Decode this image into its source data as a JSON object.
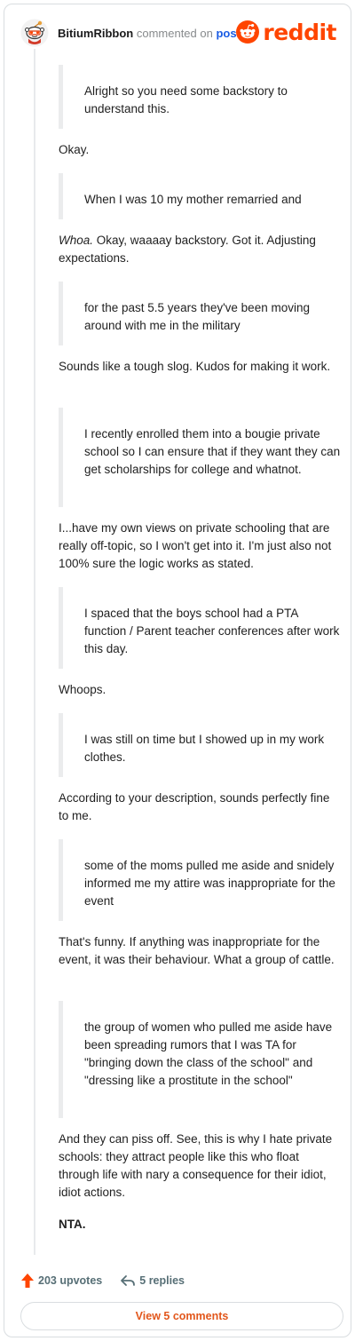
{
  "header": {
    "username": "BitiumRibbon",
    "action_text": "commented on",
    "post_link": "post",
    "brand": "reddit"
  },
  "comment": {
    "quotes": [
      "Alright so you need some backstory to understand this.",
      "When I was 10 my mother remarried and",
      "for the past 5.5 years they've been moving around with me in the military",
      "I recently enrolled them into a bougie private school so I can ensure that if they want they can get scholarships for college and whatnot.",
      "I spaced that the boys school had a PTA function / Parent teacher conferences after work this day.",
      "I was still on time but I showed up in my work clothes.",
      "some of the moms pulled me aside and snidely informed me my attire was inappropriate for the event",
      "the group of women who pulled me aside have been spreading rumors that I was TA for \"bringing down the class of the school\" and \"dressing like a prostitute in the school\""
    ],
    "replies": [
      "Okay.",
      "Okay, waaaay backstory. Got it. Adjusting expectations.",
      "Sounds like a tough slog. Kudos for making it work.",
      "I...have my own views on private schooling that are really off-topic, so I won't get into it. I'm just also not 100% sure the logic works as stated.",
      "Whoops.",
      "According to your description, sounds perfectly fine to me.",
      "That's funny. If anything was inappropriate for the event, it was their behaviour. What a group of cattle.",
      "And they can piss off. See, this is why I hate private schools: they attract people like this who float through life with nary a consequence for their idiot, idiot actions.",
      "NTA."
    ],
    "reply_2_emphasis": "Whoa."
  },
  "footer": {
    "upvotes": "203 upvotes",
    "replies": "5 replies",
    "view_comments": "View 5 comments"
  },
  "colors": {
    "brand": "#ff4500",
    "link": "#1a5ce4",
    "muted": "#878a8c",
    "quote_bar": "#ebeced",
    "button_text": "#e2571c"
  }
}
